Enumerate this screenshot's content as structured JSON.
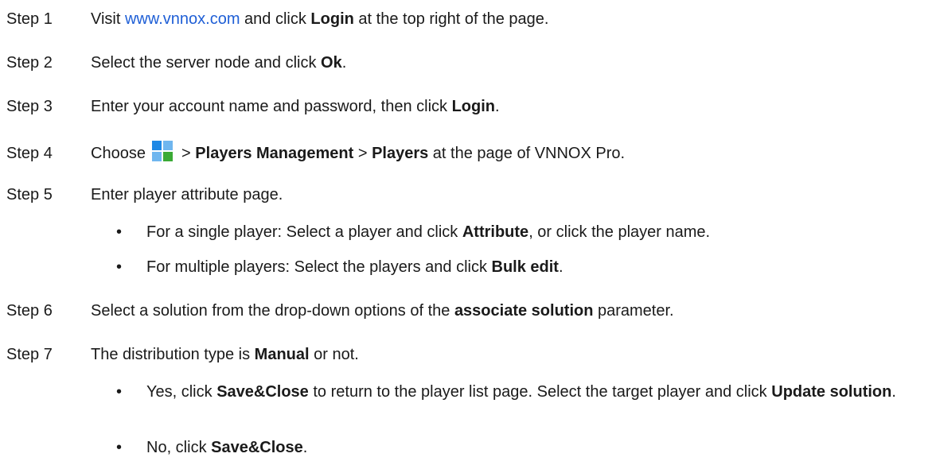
{
  "steps": [
    {
      "label": "Step 1",
      "parts": {
        "a": "Visit ",
        "link": "www.vnnox.com",
        "b": " and click ",
        "bold1": "Login",
        "c": " at the top right of the page."
      }
    },
    {
      "label": "Step 2",
      "parts": {
        "a": "Select the server node and click ",
        "bold1": "Ok",
        "c": "."
      }
    },
    {
      "label": "Step 3",
      "parts": {
        "a": "Enter your account name and password, then click ",
        "bold1": "Login",
        "c": "."
      }
    },
    {
      "label": "Step 4",
      "parts": {
        "a": "Choose",
        "icon": "windows-grid-icon",
        "sep1": " > ",
        "bold1": "Players Management",
        "sep2": " > ",
        "bold2": "Players",
        "c": " at the page of VNNOX Pro."
      }
    },
    {
      "label": "Step 5",
      "parts": {
        "a": "Enter player attribute page."
      },
      "bullets": [
        {
          "a": "For a single player: Select a player and click ",
          "bold1": "Attribute",
          "c": ", or click the player name."
        },
        {
          "a": "For multiple players: Select the players and click ",
          "bold1": "Bulk edit",
          "c": "."
        }
      ]
    },
    {
      "label": "Step 6",
      "parts": {
        "a": "Select a solution from the drop-down options of the ",
        "bold1": "associate solution",
        "c": " parameter."
      }
    },
    {
      "label": "Step 7",
      "parts": {
        "a": "The distribution type is ",
        "bold1": "Manual",
        "c": " or not."
      },
      "bullets": [
        {
          "a": "Yes, click ",
          "bold1": "Save&Close",
          "b": " to return to the player list page. Select the target player and click ",
          "bold2": "Update solution",
          "c": "."
        },
        {
          "a": "No, click ",
          "bold1": "Save&Close",
          "c": "."
        }
      ]
    }
  ],
  "bullet_symbol": "•",
  "colors": {
    "text": "#1a1a1a",
    "link": "#1f5fd6",
    "icon_blue": "#1e88e5",
    "icon_green": "#3aaa35"
  }
}
